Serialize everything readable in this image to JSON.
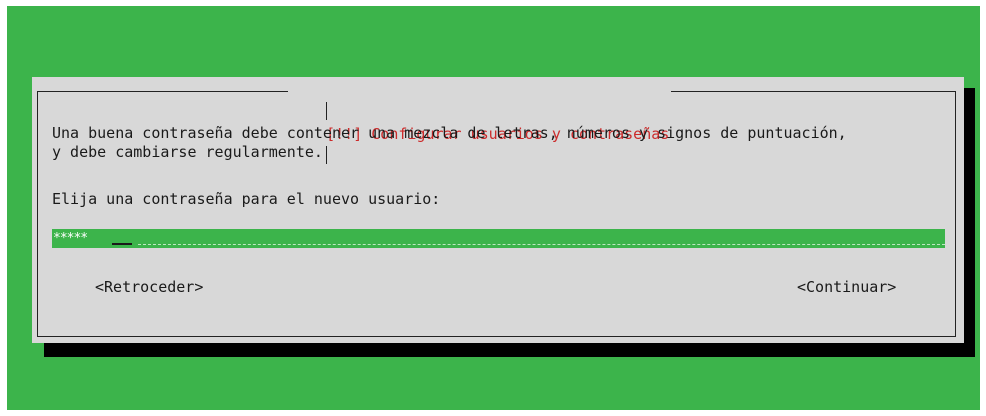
{
  "dialog": {
    "title": "[!!] Configurar usuarios y contraseñas",
    "line1": "Una buena contraseña debe contener una mezcla de letras, números y signos de puntuación,",
    "line2": "y debe cambiarse regularmente.",
    "prompt": "Elija una contraseña para el nuevo usuario:",
    "password_field": {
      "value": "*****"
    },
    "back_button": "<Retroceder>",
    "continue_button": "<Continuar>"
  },
  "colors": {
    "background": "#3cb44b",
    "dialog": "#d8d8d8",
    "title": "#cc2a2a",
    "shadow": "#000000"
  }
}
